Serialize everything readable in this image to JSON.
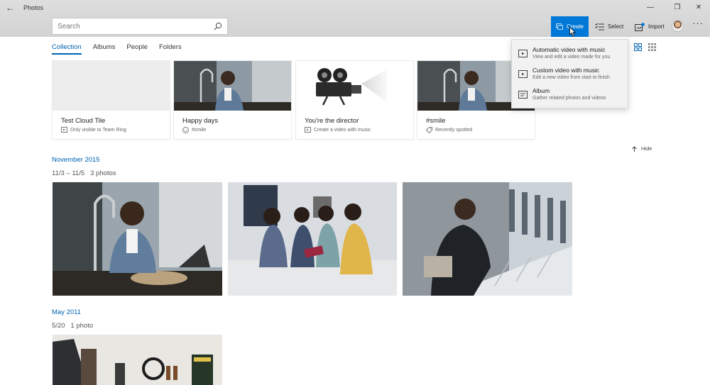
{
  "window": {
    "title": "Photos",
    "back_icon": "back-arrow-icon",
    "minimize_icon": "minimize-icon",
    "maximize_icon": "restore-icon",
    "close_icon": "close-icon"
  },
  "search": {
    "placeholder": "Search",
    "value": "",
    "icon": "search-icon"
  },
  "toolbar": {
    "create_label": "Create",
    "select_label": "Select",
    "import_label": "Import",
    "more_label": "···",
    "accent_color": "#0078d7"
  },
  "tabs": [
    {
      "label": "Collection",
      "active": true
    },
    {
      "label": "Albums",
      "active": false
    },
    {
      "label": "People",
      "active": false
    },
    {
      "label": "Folders",
      "active": false
    }
  ],
  "view_toggle": {
    "options": [
      "grid-view-icon",
      "dense-grid-view-icon"
    ]
  },
  "tiles": [
    {
      "title": "Test Cloud Tile",
      "subtitle": "Only visible to Team Ring",
      "icon": "cloud-tile-icon"
    },
    {
      "title": "Happy days",
      "subtitle": "#smile",
      "icon": "smile-icon"
    },
    {
      "title": "You're the director",
      "subtitle": "Create a video with music",
      "icon": "video-icon"
    },
    {
      "title": "#smile",
      "subtitle": "Recently spotted",
      "icon": "tag-icon"
    }
  ],
  "hide_label": "Hide",
  "sections": [
    {
      "date": "November 2015",
      "range": "11/3 – 11/5",
      "count": "3 photos"
    },
    {
      "date": "May 2011",
      "range": "5/20",
      "count": "1 photo"
    }
  ],
  "create_menu": [
    {
      "title": "Automatic video with music",
      "description": "View and edit a video made for you",
      "icon": "auto-video-icon"
    },
    {
      "title": "Custom video with music",
      "description": "Edit a new video from start to finish",
      "icon": "custom-video-icon"
    },
    {
      "title": "Album",
      "description": "Gather related photos and videos",
      "icon": "album-icon"
    }
  ]
}
